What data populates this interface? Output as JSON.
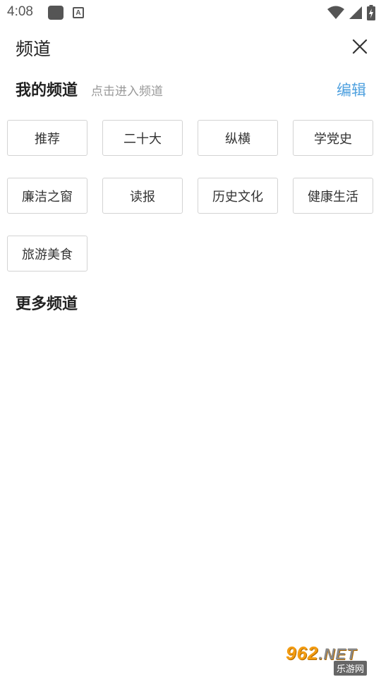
{
  "status_bar": {
    "time": "4:08",
    "icons": [
      "app-icon",
      "a-icon",
      "wifi-icon",
      "signal-icon",
      "battery-icon"
    ]
  },
  "header": {
    "title": "频道",
    "close_icon": "close-icon"
  },
  "my_channels": {
    "title": "我的频道",
    "hint": "点击进入频道",
    "edit_label": "编辑",
    "items": [
      "推荐",
      "二十大",
      "纵横",
      "学党史",
      "廉洁之窗",
      "读报",
      "历史文化",
      "健康生活",
      "旅游美食"
    ]
  },
  "more_channels": {
    "title": "更多频道"
  },
  "watermark": {
    "brand": "962",
    "suffix": ".NET",
    "subtitle": "乐游网"
  },
  "colors": {
    "accent": "#4ea0df",
    "chip_border": "#d3d3d3",
    "hint": "#999999"
  }
}
